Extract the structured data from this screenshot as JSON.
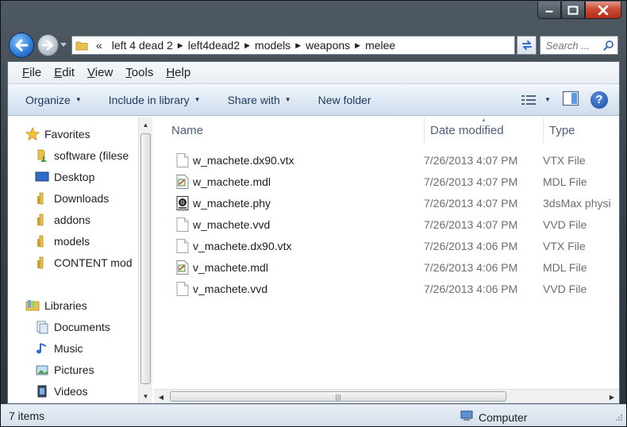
{
  "window": {
    "caption_buttons": {
      "minimize": "minimize",
      "maximize": "maximize",
      "close": "close"
    }
  },
  "address": {
    "overflow": "«",
    "crumbs": [
      "left 4 dead 2",
      "left4dead2",
      "models",
      "weapons",
      "melee"
    ]
  },
  "search": {
    "placeholder": "Search ..."
  },
  "menu": [
    {
      "key": "F",
      "rest": "ile"
    },
    {
      "key": "E",
      "rest": "dit"
    },
    {
      "key": "V",
      "rest": "iew"
    },
    {
      "key": "T",
      "rest": "ools"
    },
    {
      "key": "H",
      "rest": "elp"
    }
  ],
  "commands": {
    "organize": "Organize",
    "include_in_library": "Include in library",
    "share_with": "Share with",
    "new_folder": "New folder"
  },
  "nav": {
    "favorites": {
      "label": "Favorites",
      "items": [
        "software (filese",
        "Desktop",
        "Downloads",
        "addons",
        "models",
        "CONTENT mod"
      ]
    },
    "libraries": {
      "label": "Libraries",
      "items": [
        "Documents",
        "Music",
        "Pictures",
        "Videos"
      ]
    }
  },
  "columns": {
    "name": "Name",
    "date": "Date modified",
    "type": "Type"
  },
  "files": [
    {
      "name": "w_machete.dx90.vtx",
      "date": "7/26/2013 4:07 PM",
      "type": "VTX File",
      "icon": "blank-file-icon"
    },
    {
      "name": "w_machete.mdl",
      "date": "7/26/2013 4:07 PM",
      "type": "MDL File",
      "icon": "mdl-file-icon"
    },
    {
      "name": "w_machete.phy",
      "date": "7/26/2013 4:07 PM",
      "type": "3dsMax physi",
      "icon": "phy-file-icon"
    },
    {
      "name": "w_machete.vvd",
      "date": "7/26/2013 4:07 PM",
      "type": "VVD File",
      "icon": "blank-file-icon"
    },
    {
      "name": "v_machete.dx90.vtx",
      "date": "7/26/2013 4:06 PM",
      "type": "VTX File",
      "icon": "blank-file-icon"
    },
    {
      "name": "v_machete.mdl",
      "date": "7/26/2013 4:06 PM",
      "type": "MDL File",
      "icon": "mdl-file-icon"
    },
    {
      "name": "v_machete.vvd",
      "date": "7/26/2013 4:06 PM",
      "type": "VVD File",
      "icon": "blank-file-icon"
    }
  ],
  "status": {
    "items": "7 items",
    "location": "Computer"
  },
  "colors": {
    "accent": "#1e395b",
    "folder": "#e8c24a",
    "frame": "#3a444d"
  }
}
